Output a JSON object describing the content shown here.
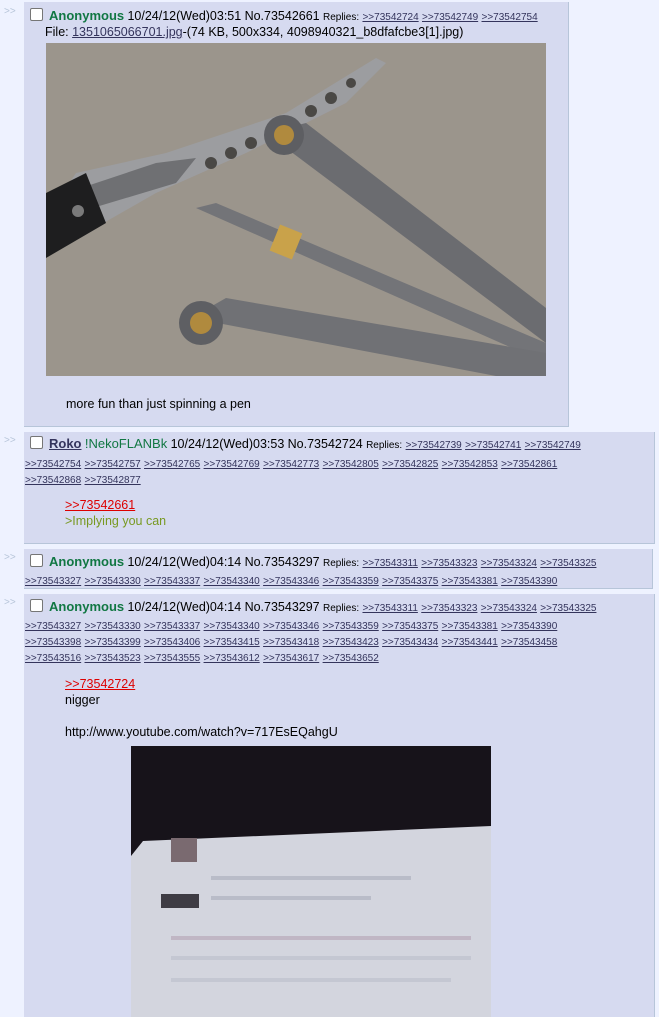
{
  "arrow": ">>",
  "posts": [
    {
      "name": "Anonymous",
      "datetime": "10/24/12(Wed)03:51",
      "number": "No.73542661",
      "replies_label": "Replies:",
      "replies": [
        ">>73542724",
        ">>73542749",
        ">>73542754"
      ],
      "file_label": "File:",
      "file_name": "1351065066701.jpg",
      "file_info": "-(74 KB, 500x334, 4098940321_b8dfafcbe3[1].jpg)",
      "image_alt": "butterfly knife and pen",
      "comment": "more fun than just spinning a pen"
    },
    {
      "name": "Roko",
      "tripcode": "!NekoFLANBk",
      "datetime": "10/24/12(Wed)03:53",
      "number": "No.73542724",
      "replies_label": "Replies:",
      "replies": [
        ">>73542739",
        ">>73542741",
        ">>73542749",
        ">>73542754",
        ">>73542757",
        ">>73542765",
        ">>73542769",
        ">>73542773",
        ">>73542805",
        ">>73542825",
        ">>73542853",
        ">>73542861",
        ">>73542868",
        ">>73542877"
      ],
      "quote_link": ">>73542661",
      "greentext": ">Implying you can"
    },
    {
      "name": "Anonymous",
      "datetime": "10/24/12(Wed)04:14",
      "number": "No.73543297",
      "replies_label": "Replies:",
      "replies": [
        ">>73543311",
        ">>73543323",
        ">>73543324",
        ">>73543325",
        ">>73543327",
        ">>73543330",
        ">>73543337",
        ">>73543340",
        ">>73543346",
        ">>73543359",
        ">>73543375",
        ">>73543381",
        ">>73543390"
      ]
    },
    {
      "name": "Anonymous",
      "datetime": "10/24/12(Wed)04:14",
      "number": "No.73543297",
      "replies_label": "Replies:",
      "replies": [
        ">>73543311",
        ">>73543323",
        ">>73543324",
        ">>73543325",
        ">>73543327",
        ">>73543330",
        ">>73543337",
        ">>73543340",
        ">>73543346",
        ">>73543359",
        ">>73543375",
        ">>73543381",
        ">>73543390",
        ">>73543398",
        ">>73543399",
        ">>73543406",
        ">>73543415",
        ">>73543418",
        ">>73543423",
        ">>73543434",
        ">>73543441",
        ">>73543458",
        ">>73543516",
        ">>73543523",
        ">>73543555",
        ">>73543612",
        ">>73543617",
        ">>73543652"
      ],
      "quote_link": ">>73542724",
      "comment_line": "nigger",
      "url": "http://www.youtube.com/watch?v=717EsEQahgU",
      "image_alt": "photo of a computer screen"
    }
  ]
}
